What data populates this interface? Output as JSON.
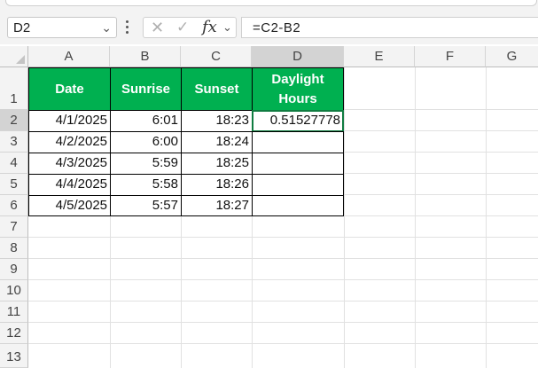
{
  "name_box": {
    "value": "D2"
  },
  "formula_bar": {
    "formula": "=C2-B2",
    "fx_label": "fx"
  },
  "columns": [
    "A",
    "B",
    "C",
    "D",
    "E",
    "F",
    "G"
  ],
  "rows": [
    "1",
    "2",
    "3",
    "4",
    "5",
    "6",
    "7",
    "8",
    "9",
    "10",
    "11",
    "12",
    "13"
  ],
  "table": {
    "headers": [
      "Date",
      "Sunrise",
      "Sunset",
      "Daylight",
      "Hours"
    ],
    "rows": [
      [
        "4/1/2025",
        "6:01",
        "18:23",
        "0.51527778"
      ],
      [
        "4/2/2025",
        "6:00",
        "18:24",
        ""
      ],
      [
        "4/3/2025",
        "5:59",
        "18:25",
        ""
      ],
      [
        "4/4/2025",
        "5:58",
        "18:26",
        ""
      ],
      [
        "4/5/2025",
        "5:57",
        "18:27",
        ""
      ]
    ]
  },
  "colors": {
    "header_fill": "#00b050",
    "selection": "#107c41"
  }
}
